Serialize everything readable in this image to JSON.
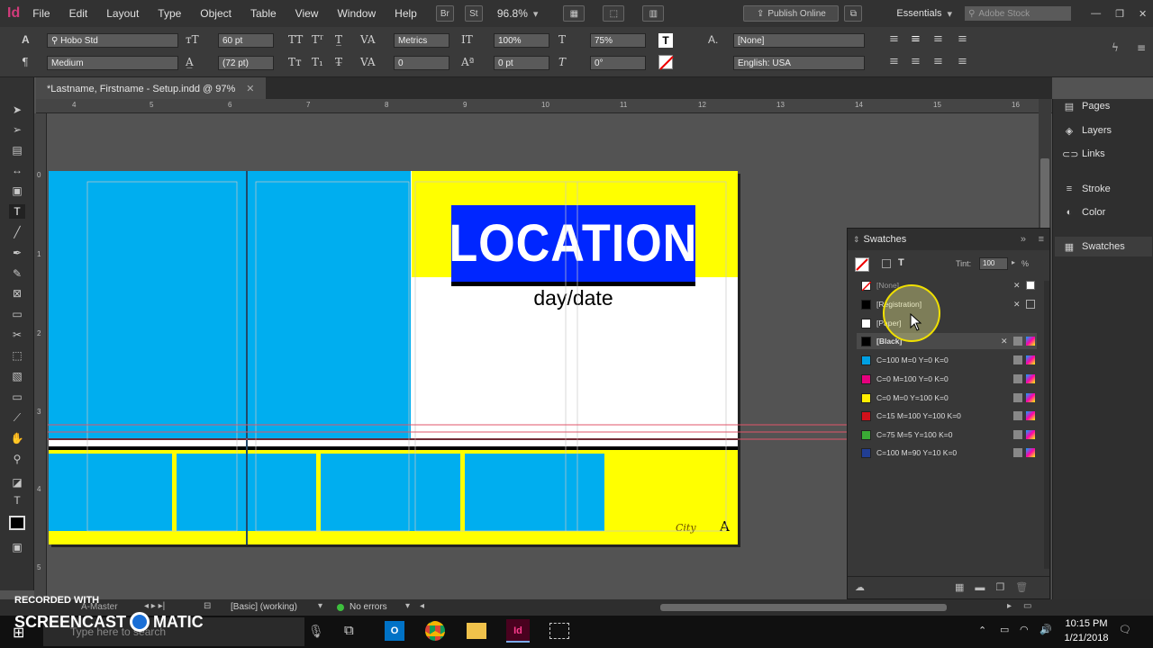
{
  "app": {
    "logo": "Id",
    "menu": [
      "File",
      "Edit",
      "Layout",
      "Type",
      "Object",
      "Table",
      "View",
      "Window",
      "Help"
    ],
    "br": "Br",
    "st": "St",
    "zoom": "96.8%",
    "publish": "Publish Online",
    "workspace": "Essentials",
    "search_placeholder": "Adobe Stock"
  },
  "control": {
    "font": "Hobo Std",
    "style": "Medium",
    "size": "60 pt",
    "leading": "(72 pt)",
    "kerning": "Metrics",
    "tracking": "0",
    "vscale": "100%",
    "hscale": "75%",
    "baseline": "0 pt",
    "skew": "0°",
    "para_style": "[None]",
    "language": "English: USA"
  },
  "doc": {
    "tab": "*Lastname, Firstname - Setup.indd @ 97%"
  },
  "ruler": {
    "h": [
      "4",
      "5",
      "6",
      "7",
      "8",
      "9",
      "10",
      "11",
      "12",
      "13",
      "14",
      "15",
      "16"
    ],
    "v": [
      "0",
      "1",
      "2",
      "3",
      "4",
      "5"
    ]
  },
  "artwork": {
    "location": "LOCATION",
    "daydate": "day/date",
    "city": "City",
    "corner": "A"
  },
  "panel": {
    "items": [
      "Pages",
      "Layers",
      "Links",
      "Stroke",
      "Color",
      "Swatches"
    ]
  },
  "swatches": {
    "title": "Swatches",
    "tint_label": "Tint:",
    "tint": "100",
    "pct": "%",
    "items": [
      {
        "name": "[None]",
        "color": "#ffffff"
      },
      {
        "name": "[Registration]",
        "color": "#000000"
      },
      {
        "name": "[Paper]",
        "color": "#ffffff"
      },
      {
        "name": "[Black]",
        "color": "#000000"
      },
      {
        "name": "C=100 M=0 Y=0 K=0",
        "color": "#00a0e3"
      },
      {
        "name": "C=0 M=100 Y=0 K=0",
        "color": "#e6007e"
      },
      {
        "name": "C=0 M=0 Y=100 K=0",
        "color": "#ffed00"
      },
      {
        "name": "C=15 M=100 Y=100 K=0",
        "color": "#d0111b"
      },
      {
        "name": "C=75 M=5 Y=100 K=0",
        "color": "#3aaa35"
      },
      {
        "name": "C=100 M=90 Y=10 K=0",
        "color": "#213e93"
      }
    ]
  },
  "status": {
    "page": "A-Master",
    "style": "[Basic] (working)",
    "errors": "No errors"
  },
  "watermark": {
    "line1": "RECORDED WITH",
    "line2": "SCREENCAST",
    "line3": "MATIC"
  },
  "taskbar": {
    "search_placeholder": "Type here to search",
    "time": "10:15 PM",
    "date": "1/21/2018"
  }
}
